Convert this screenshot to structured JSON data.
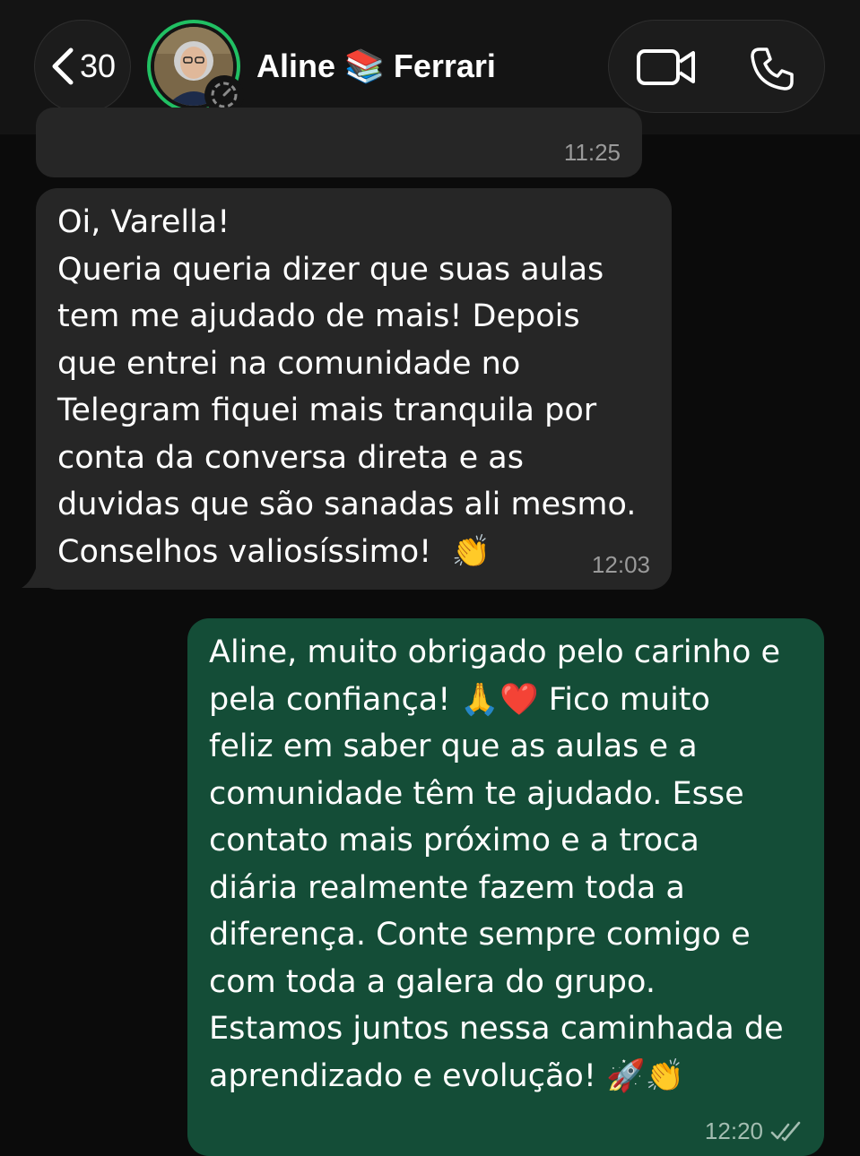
{
  "header": {
    "back_count": "30",
    "contact_name": "Aline 📚 Ferrari",
    "accent_color": "#21c063"
  },
  "messages": {
    "previous": {
      "time": "11:25"
    },
    "incoming": {
      "text": "Oi, Varella!\nQueria queria dizer que suas aulas\ntem me ajudado de mais! Depois\nque entrei na comunidade no\nTelegram fiquei mais tranquila por\nconta da conversa direta e as\nduvidas que são sanadas ali mesmo.\nConselhos valiosíssimo!  👏",
      "time": "12:03"
    },
    "outgoing": {
      "text": "Aline, muito obrigado pelo carinho e\npela confiança! 🙏❤️ Fico muito\nfeliz em saber que as aulas e a\ncomunidade têm te ajudado. Esse\ncontato mais próximo e a troca\ndiária realmente fazem toda a\ndiferença. Conte sempre comigo e\ncom toda a galera do grupo.\nEstamos juntos nessa caminhada de\naprendizado e evolução! 🚀👏",
      "time": "12:20",
      "status_icon": "double-check-icon"
    }
  },
  "colors": {
    "incoming_bubble": "#262626",
    "outgoing_bubble": "#144d37",
    "background": "#0b0b0b"
  }
}
